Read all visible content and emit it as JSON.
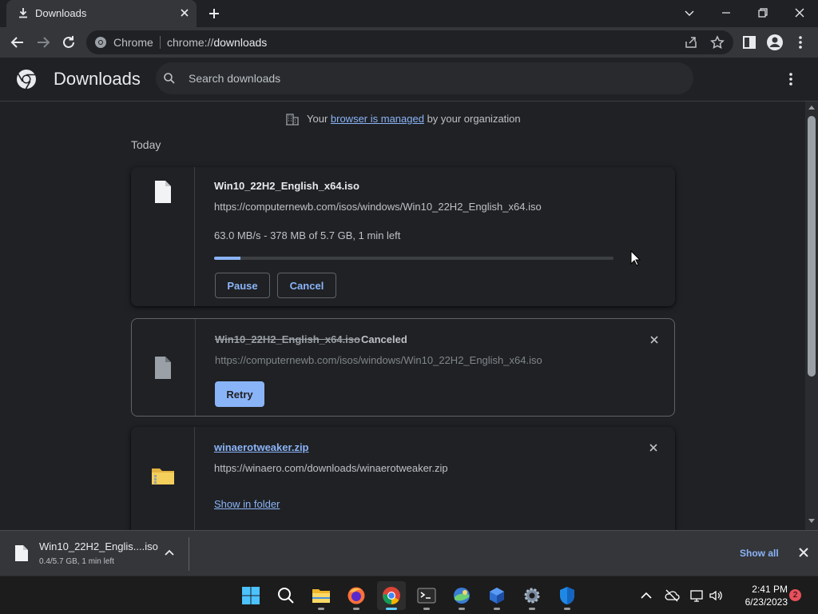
{
  "tab": {
    "title": "Downloads"
  },
  "omnibox": {
    "site_label": "Chrome",
    "url_scheme": "chrome://",
    "url_host": "downloads"
  },
  "header": {
    "title": "Downloads",
    "search_placeholder": "Search downloads"
  },
  "managed_notice": {
    "prefix": "Your ",
    "link": "browser is managed",
    "suffix": " by your organization"
  },
  "section_label": "Today",
  "downloads": [
    {
      "filename": "Win10_22H2_English_x64.iso",
      "url": "https://computernewb.com/isos/windows/Win10_22H2_English_x64.iso",
      "status": "63.0 MB/s - 378 MB of 5.7 GB, 1 min left",
      "progress": 0.066,
      "pause_label": "Pause",
      "cancel_label": "Cancel"
    },
    {
      "filename": "Win10_22H2_English_x64.iso",
      "state": "Canceled",
      "url": "https://computernewb.com/isos/windows/Win10_22H2_English_x64.iso",
      "retry_label": "Retry"
    },
    {
      "filename": "winaerotweaker.zip",
      "url": "https://winaero.com/downloads/winaerotweaker.zip",
      "show_in_folder_label": "Show in folder"
    }
  ],
  "shelf": {
    "filename": "Win10_22H2_Englis....iso",
    "status": "0.4/5.7 GB, 1 min left",
    "show_all_label": "Show all"
  },
  "taskbar": {
    "time": "2:41 PM",
    "date": "6/23/2023",
    "notification_count": "2"
  },
  "colors": {
    "accent": "#8ab4f8",
    "background": "#202124",
    "toolbar": "#35363a"
  }
}
